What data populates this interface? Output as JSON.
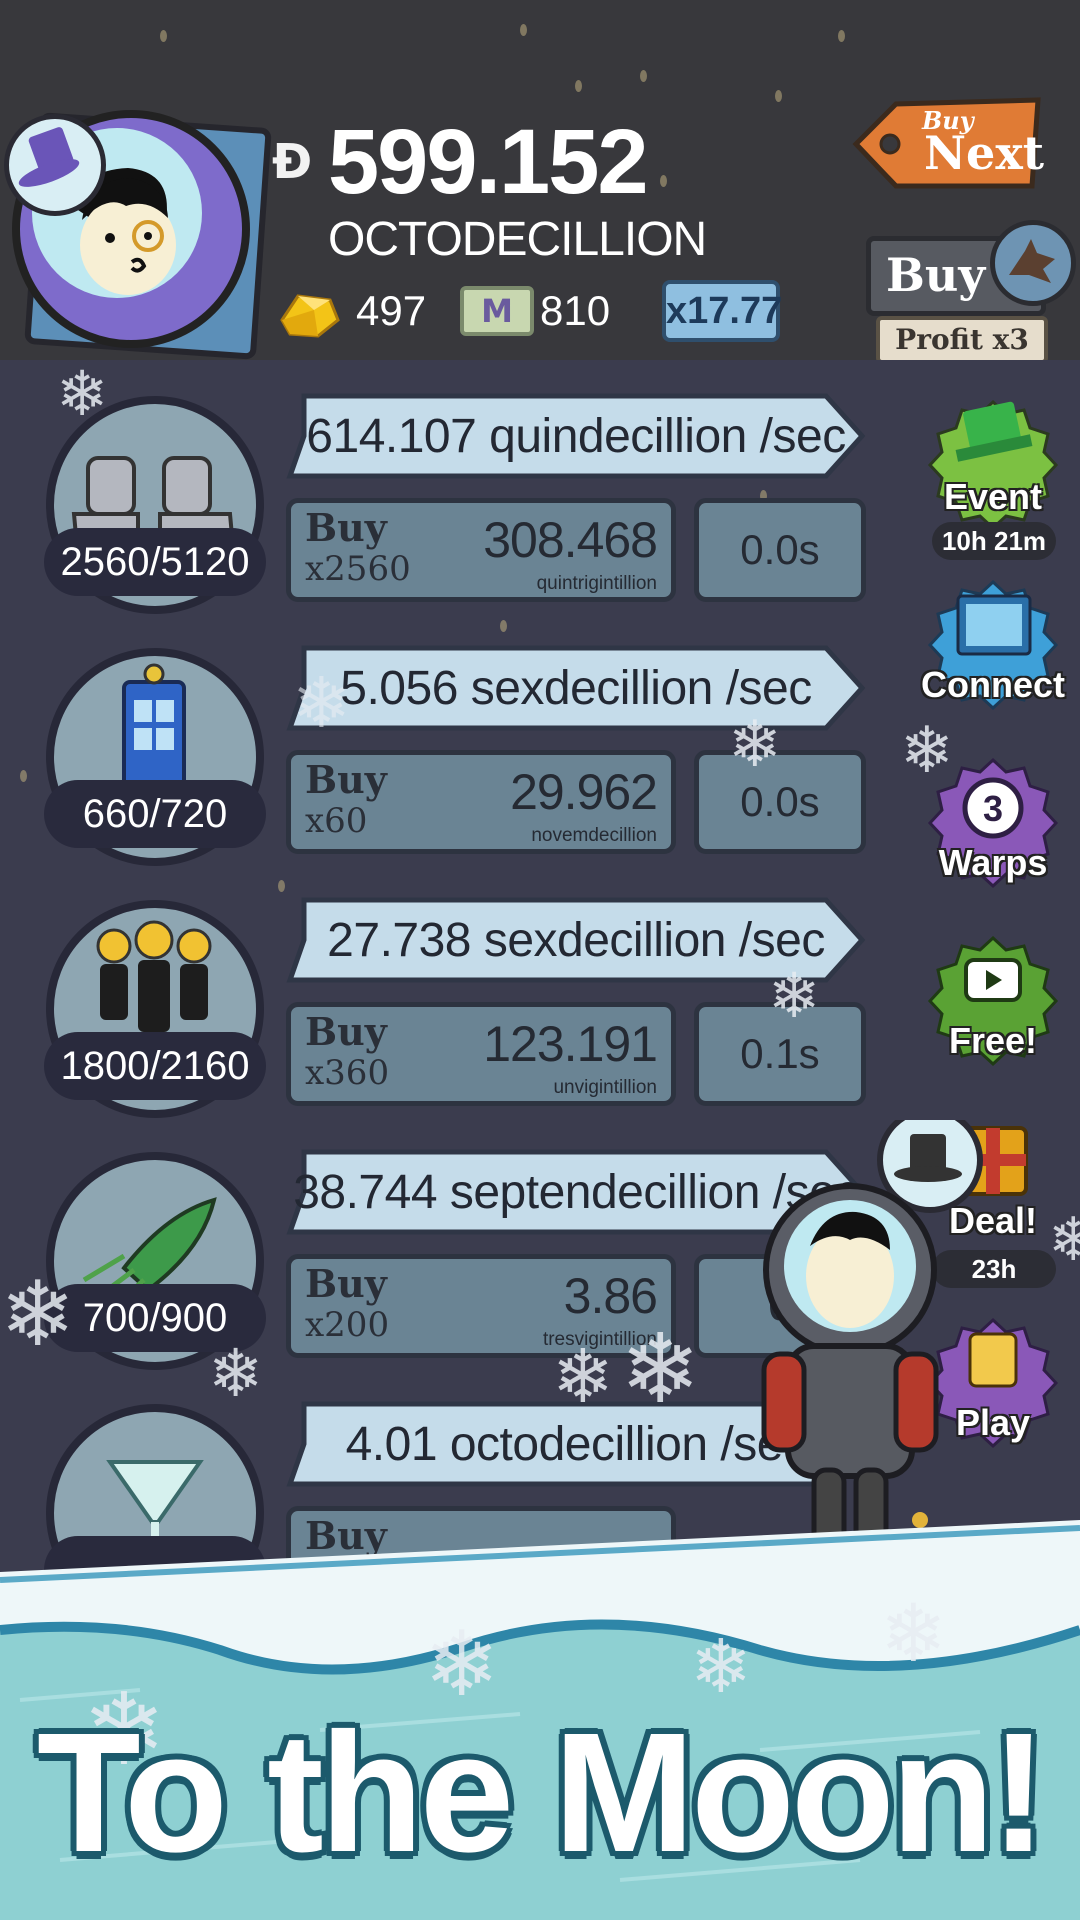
{
  "header": {
    "money_value": "599.152",
    "money_unit": "OCTODECILLION",
    "gold_count": "497",
    "megabucks_count": "810",
    "megabucks_symbol": "M",
    "multiplier": "x17.77",
    "buy_next_small": "Buy",
    "buy_next_big": "Next",
    "buy_label": "Buy",
    "profit_label": "Profit x3"
  },
  "businesses": [
    {
      "icon": "moon-boots-icon",
      "count": "2560/5120",
      "rate": "614.107 quindecillion /sec",
      "buy_label": "Buy",
      "buy_qty": "x2560",
      "cost_value": "308.468",
      "cost_unit": "quintrigintillion",
      "time": "0.0s"
    },
    {
      "icon": "phone-booth-icon",
      "count": "660/720",
      "rate": "5.056 sexdecillion /sec",
      "buy_label": "Buy",
      "buy_qty": "x60",
      "cost_value": "29.962",
      "cost_unit": "novemdecillion",
      "time": "0.0s"
    },
    {
      "icon": "clones-icon",
      "count": "1800/2160",
      "rate": "27.738 sexdecillion /sec",
      "buy_label": "Buy",
      "buy_qty": "x360",
      "cost_value": "123.191",
      "cost_unit": "unvigintillion",
      "time": "0.1s"
    },
    {
      "icon": "rocket-icon",
      "count": "700/900",
      "rate": "38.744 septendecillion /sec",
      "buy_label": "Buy",
      "buy_qty": "x200",
      "cost_value": "3.86",
      "cost_unit": "tresvigintillion",
      "time": "0"
    },
    {
      "icon": "cocktail-icon",
      "count": "",
      "rate": "4.01 octodecillion /sec",
      "buy_label": "Buy",
      "buy_qty": "",
      "cost_value": "",
      "cost_unit": "",
      "time": ""
    }
  ],
  "side_buttons": {
    "event": {
      "label": "Event",
      "sub": "10h 21m",
      "color": "#7cc142"
    },
    "connect": {
      "label": "Connect",
      "color": "#3ea0d8"
    },
    "warps": {
      "label": "Warps",
      "badge": "3",
      "color": "#8a58b8"
    },
    "free": {
      "label": "Free!",
      "color": "#5aa234"
    },
    "deal": {
      "label": "Deal!",
      "sub": "23h",
      "color": "#e3a21a"
    },
    "play": {
      "label": "Play",
      "color": "#8a58b8"
    }
  },
  "banner": {
    "title": "To the Moon!"
  },
  "colors": {
    "top_bg": "#38383c",
    "list_bg": "#3b3c4e",
    "banner_water": "#8ed0d2",
    "title_outline": "#1c5a6c",
    "buy_next_tag": "#e07b35"
  }
}
